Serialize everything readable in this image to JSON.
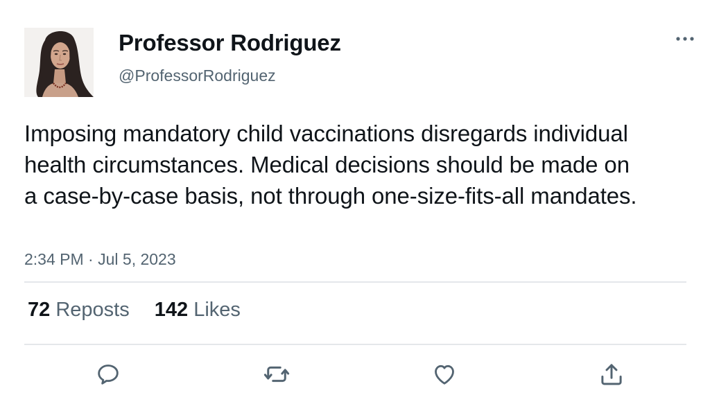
{
  "author": {
    "display_name": "Professor Rodriguez",
    "handle": "@ProfessorRodriguez"
  },
  "tweet": {
    "text": "Imposing mandatory child vaccinations disregards individual health circumstances. Medical decisions should be made on a case-by-case basis, not through one-size-fits-all mandates.",
    "time": "2:34 PM",
    "separator": "·",
    "date": "Jul 5, 2023"
  },
  "stats": {
    "reposts_count": "72",
    "reposts_label": "Reposts",
    "likes_count": "142",
    "likes_label": "Likes"
  },
  "actions": [
    "reply-icon",
    "repost-icon",
    "like-icon",
    "share-icon"
  ],
  "colors": {
    "text_primary": "#0f1419",
    "text_secondary": "#536471",
    "divider": "#e4e7ea",
    "icon": "#536471",
    "background": "#ffffff"
  }
}
